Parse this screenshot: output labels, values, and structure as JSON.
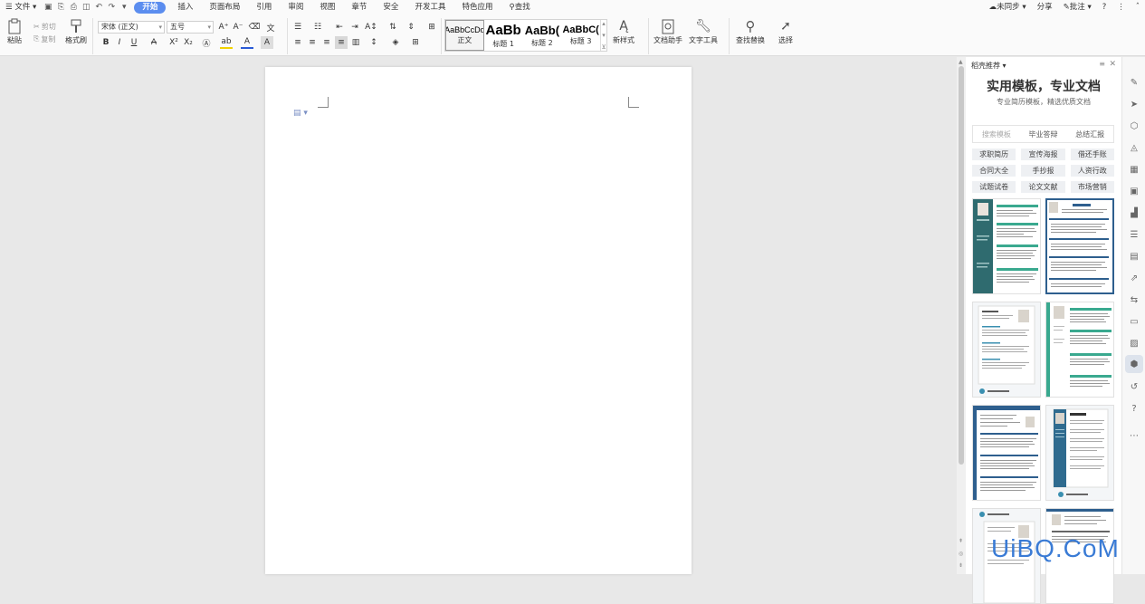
{
  "menubar": {
    "file_label": "文件",
    "tabs": [
      {
        "label": "开始",
        "active": true
      },
      {
        "label": "插入"
      },
      {
        "label": "页面布局"
      },
      {
        "label": "引用"
      },
      {
        "label": "审阅"
      },
      {
        "label": "视图"
      },
      {
        "label": "章节"
      },
      {
        "label": "安全"
      },
      {
        "label": "开发工具"
      },
      {
        "label": "特色应用"
      }
    ],
    "search_label": "查找",
    "sync_label": "未同步",
    "share_label": "分享",
    "comment_label": "批注"
  },
  "ribbon": {
    "paste_label": "粘贴",
    "cut_label": "剪切",
    "copy_label": "复制",
    "format_painter_label": "格式刷",
    "font_name": "宋体 (正文)",
    "font_size": "五号",
    "styles": [
      {
        "sample": "AaBbCcDd",
        "label": "正文",
        "selected": true
      },
      {
        "sample": "AaBb",
        "label": "标题 1"
      },
      {
        "sample": "AaBb(",
        "label": "标题 2"
      },
      {
        "sample": "AaBbC(",
        "label": "标题 3"
      }
    ],
    "new_style_label": "新样式",
    "doc_assistant_label": "文档助手",
    "text_tools_label": "文字工具",
    "find_replace_label": "查找替换",
    "select_label": "选择"
  },
  "panel": {
    "title": "稻壳推荐",
    "heading": "实用模板，专业文档",
    "subheading": "专业简历模板，精选优质文档",
    "search_placeholder": "搜索模板",
    "search_tabs": [
      "毕业答辩",
      "总结汇报"
    ],
    "tags": [
      "求职简历",
      "宣传海报",
      "借还手账",
      "合同大全",
      "手抄报",
      "人资行政",
      "试题试卷",
      "论文文献",
      "市场营销"
    ]
  },
  "watermark": "UiBQ.CoM",
  "colors": {
    "accent": "#5b8def",
    "resume_teal": "#2f6b6f",
    "resume_blue": "#2e5f8e",
    "resume_green": "#3aa98f"
  }
}
